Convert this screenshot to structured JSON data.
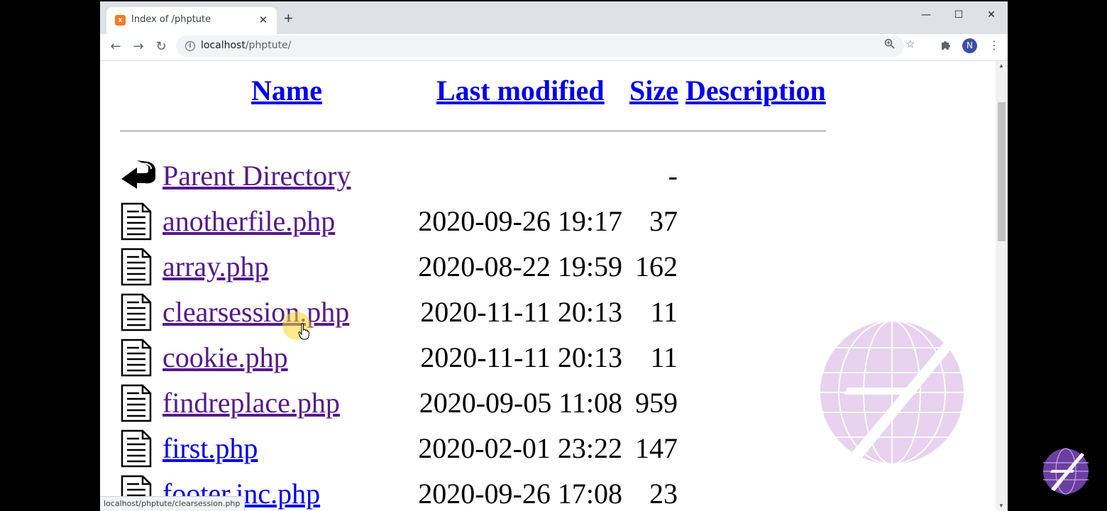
{
  "browser": {
    "tab_title": "Index of /phptute",
    "tab_close": "✕",
    "new_tab": "+",
    "url_host": "localhost",
    "url_path": "/phptute/",
    "avatar_letter": "N",
    "status_url": "localhost/phptute/clearsession.php"
  },
  "listing": {
    "headers": {
      "name": "Name",
      "modified": "Last modified",
      "size": "Size",
      "description": "Description"
    },
    "parent": {
      "name": "Parent Directory",
      "size": "-"
    },
    "files": [
      {
        "name": "anotherfile.php",
        "modified": "2020-09-26 19:17",
        "size": "37",
        "visited": true
      },
      {
        "name": "array.php",
        "modified": "2020-08-22 19:59",
        "size": "162",
        "visited": true
      },
      {
        "name": "clearsession.php",
        "modified": "2020-11-11 20:13",
        "size": "11",
        "visited": true
      },
      {
        "name": "cookie.php",
        "modified": "2020-11-11 20:13",
        "size": "11",
        "visited": true
      },
      {
        "name": "findreplace.php",
        "modified": "2020-09-05 11:08",
        "size": "959",
        "visited": true
      },
      {
        "name": "first.php",
        "modified": "2020-02-01 23:22",
        "size": "147",
        "visited": false
      },
      {
        "name": "footer.inc.php",
        "modified": "2020-09-26 17:08",
        "size": "23",
        "visited": false
      }
    ]
  },
  "colors": {
    "link": "#0000ee",
    "visited": "#551a8b",
    "tabstrip": "#dee1e6",
    "cursor_highlight": "#fad728"
  }
}
